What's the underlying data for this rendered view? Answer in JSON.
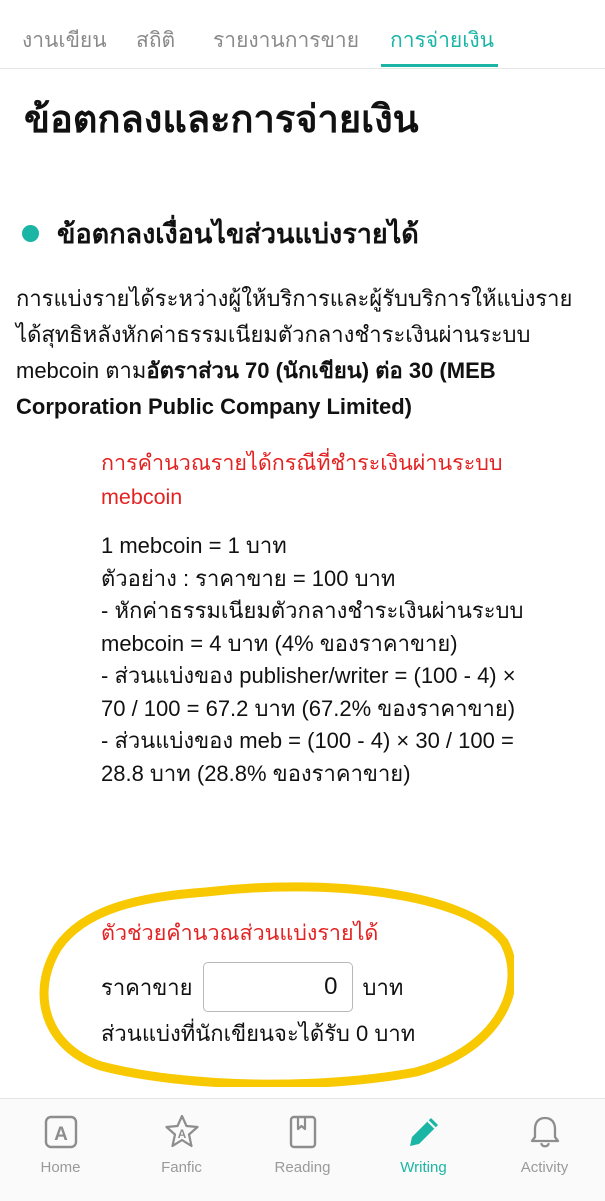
{
  "tabs": [
    "งานเขียน",
    "สถิติ",
    "รายงานการขาย",
    "การจ่ายเงิน"
  ],
  "page_title": "ข้อตกลงและการจ่ายเงิน",
  "section_heading": "ข้อตกลงเงื่อนไขส่วนแบ่งรายได้",
  "intro": {
    "text": "การแบ่งรายได้ระหว่างผู้ให้บริการและผู้รับบริการให้แบ่งรายได้สุทธิหลังหักค่าธรรมเนียมตัวกลางชำระเงินผ่านระบบ mebcoin ตาม",
    "bold": "อัตราส่วน 70 (นักเขียน) ต่อ 30 (MEB Corporation Public Company Limited)"
  },
  "calc": {
    "title": "การคำนวณรายได้กรณีที่ชำระเงินผ่านระบบ mebcoin",
    "lines": [
      "1 mebcoin = 1 บาท",
      "ตัวอย่าง : ราคาขาย = 100 บาท",
      "- หักค่าธรรมเนียมตัวกลางชำระเงินผ่านระบบ mebcoin = 4 บาท (4% ของราคาขาย)",
      "- ส่วนแบ่งของ publisher/writer = (100 - 4) × 70 / 100 = 67.2 บาท (67.2% ของราคาขาย)",
      "- ส่วนแบ่งของ meb = (100 - 4) × 30 / 100 = 28.8 บาท (28.8% ของราคาขาย)"
    ]
  },
  "helper": {
    "title": "ตัวช่วยคำนวณส่วนแบ่งรายได้",
    "price_label": "ราคาขาย",
    "price_value": "0",
    "unit": "บาท",
    "result_label": "ส่วนแบ่งที่นักเขียนจะได้รับ",
    "result_value": "0",
    "result_unit": "บาท"
  },
  "bottom_nav": [
    {
      "label": "Home",
      "icon": "home-a-icon"
    },
    {
      "label": "Fanfic",
      "icon": "fanfic-star-icon"
    },
    {
      "label": "Reading",
      "icon": "book-icon"
    },
    {
      "label": "Writing",
      "icon": "pencil-icon",
      "active": true
    },
    {
      "label": "Activity",
      "icon": "bell-icon"
    }
  ],
  "colors": {
    "accent": "#1ab5a5",
    "red": "#e32222",
    "highlight": "#f8c800"
  }
}
